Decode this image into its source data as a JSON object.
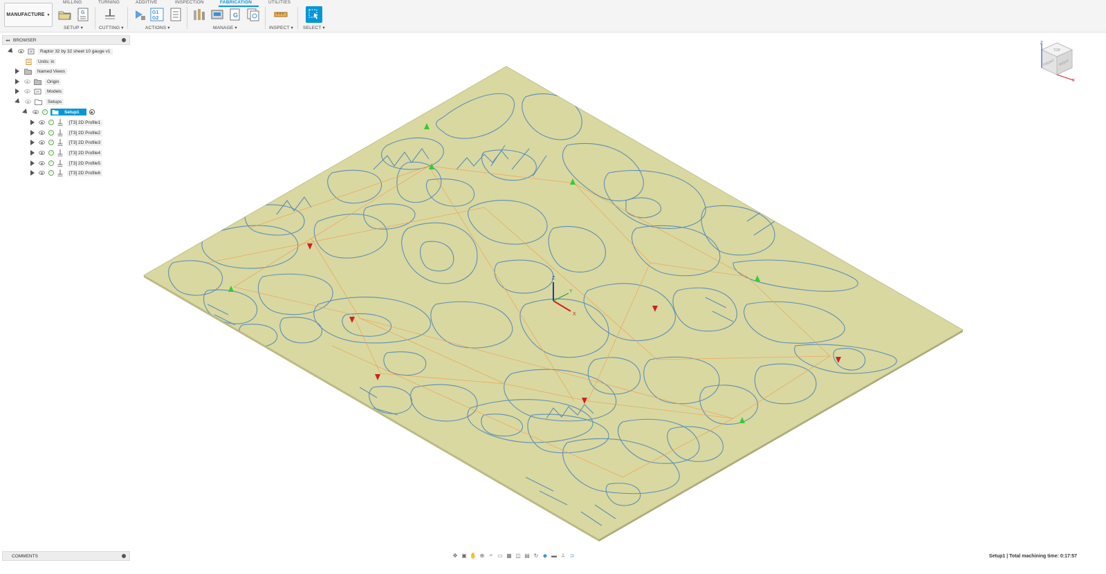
{
  "toolbar": {
    "workspace_label": "MANUFACTURE",
    "tabs": [
      "MILLING",
      "TURNING",
      "ADDITIVE",
      "INSPECTION",
      "FABRICATION",
      "UTILITIES"
    ],
    "active_tab": "FABRICATION",
    "groups": {
      "setup": "SETUP",
      "cutting": "CUTTING",
      "actions": "ACTIONS",
      "manage": "MANAGE",
      "inspect": "INSPECT",
      "select": "SELECT"
    },
    "accent_color": "#0696d7"
  },
  "browser": {
    "title": "BROWSER",
    "root": "Raptor 32 by 32 sheet 10 gauge v1",
    "units": "Units: in",
    "nodes": [
      "Named Views",
      "Origin",
      "Models",
      "Setups"
    ],
    "setup": "Setup1",
    "operations": [
      "[T3] 2D Profile1",
      "[T3] 2D Profile2",
      "[T3] 2D Profile3",
      "[T3] 2D Profile4",
      "[T3] 2D Profile5",
      "[T3] 2D Profile6"
    ]
  },
  "comments": {
    "title": "COMMENTS"
  },
  "status": {
    "text": "Setup1 | Total machining time: 0:17:57"
  },
  "viewcube": {
    "top": "TOP",
    "front": "FRONT",
    "right": "RIGHT",
    "axis_x": "X",
    "axis_z": "Z"
  },
  "viewport": {
    "sheet_color": "#d9d8a1",
    "edge_color": "#b9b885",
    "path_color": "#5b8fb5",
    "rapid_color": "#f0a050",
    "origin_labels": {
      "x": "X",
      "y": "Y",
      "z": "Z"
    }
  }
}
